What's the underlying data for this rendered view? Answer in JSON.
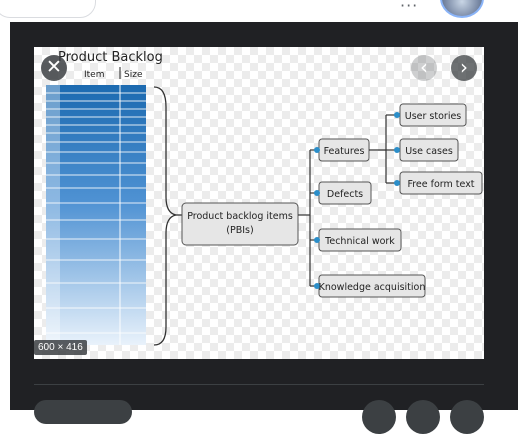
{
  "top_bar": {
    "more_icon": "⋮",
    "more_glyph": "···"
  },
  "viewer": {
    "close_glyph": "✕",
    "prev_glyph": "‹",
    "next_glyph": "›",
    "size_badge": "600 × 416"
  },
  "diagram": {
    "backlog_title": "Product Backlog",
    "col_item": "Item",
    "col_size": "Size",
    "center_line1": "Product backlog items",
    "center_line2": "(PBIs)",
    "features": "Features",
    "defects": "Defects",
    "technical_work": "Technical work",
    "knowledge_acquisition": "Knowledge acquisition",
    "user_stories": "User stories",
    "use_cases": "Use cases",
    "free_form_text": "Free form text"
  },
  "colors": {
    "panel_bg": "#202124",
    "stack_blue": "#1f6fb5",
    "box_fill": "#e6e6e6",
    "connector_dot": "#2b8ec9"
  }
}
